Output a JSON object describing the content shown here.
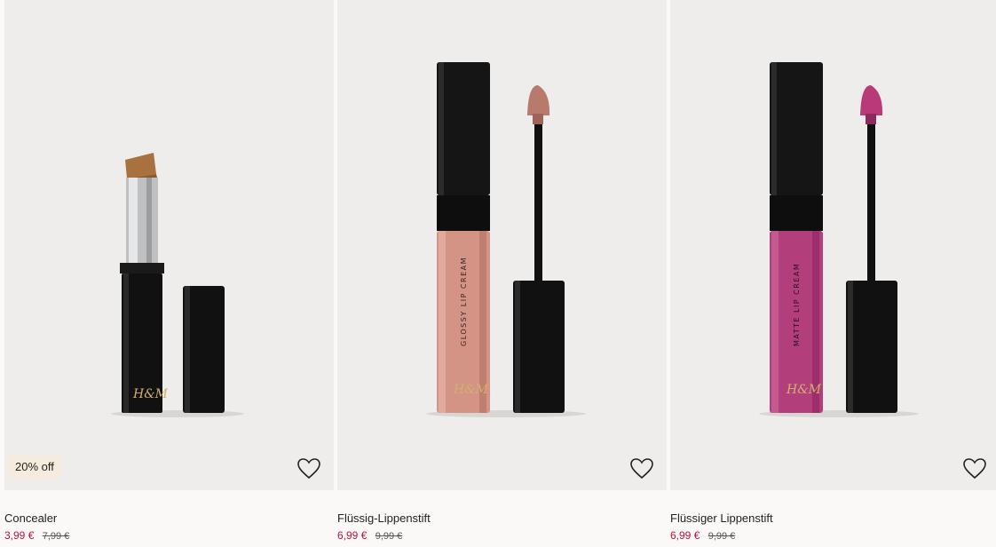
{
  "products": [
    {
      "name": "Concealer",
      "price": "3,99 €",
      "original_price": "7,99 €",
      "badge": "20% off",
      "brand_mark": "H&M",
      "tip_color": "#a9713e"
    },
    {
      "name": "Flüssig-Lippenstift",
      "price": "6,99 €",
      "original_price": "9,99 €",
      "tube_label": "GLOSSY LIP CREAM",
      "brand_mark": "H&M",
      "tip_color": "#b87a6c",
      "tube_color": "#d49485"
    },
    {
      "name": "Flüssiger Lippenstift",
      "price": "6,99 €",
      "original_price": "9,99 €",
      "tube_label": "MATTE LIP CREAM",
      "brand_mark": "H&M",
      "tip_color": "#b93a78",
      "tube_color": "#b23f7c"
    }
  ],
  "colors": {
    "sale_price": "#c40e3c",
    "image_bg": "#eeedeb",
    "badge_bg": "#f6ecde"
  }
}
